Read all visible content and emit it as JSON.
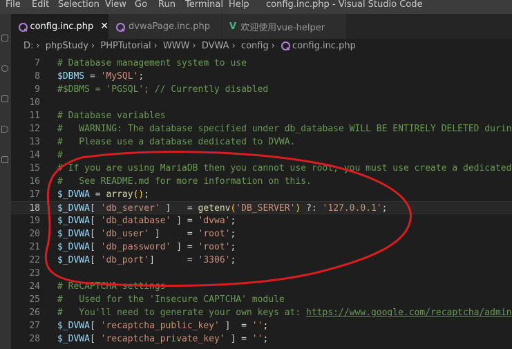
{
  "menu": {
    "items": [
      "File",
      "Edit",
      "Selection",
      "View",
      "Go",
      "Run",
      "Terminal",
      "Help"
    ],
    "window_title": "config.inc.php - Visual Studio Code"
  },
  "tabs": [
    {
      "label": "config.inc.php",
      "icon": "php-icon",
      "active": true,
      "close": "✕"
    },
    {
      "label": "dvwaPage.inc.php",
      "icon": "php-icon",
      "active": false
    },
    {
      "label": "欢迎使用vue-helper",
      "icon": "vue-icon",
      "active": false
    }
  ],
  "breadcrumb": [
    "D:",
    "phpStudy",
    "PHPTutorial",
    "WWW",
    "DVWA",
    "config",
    "config.inc.php"
  ],
  "breadcrumb_sep": "›",
  "colors": {
    "annotation": "#d81e1e",
    "comment": "#6a9955",
    "variable": "#9cdcfe",
    "string": "#ce9178",
    "function": "#dcdcaa"
  },
  "annotation_shape": "red freehand ellipse around lines 15-23",
  "editor": {
    "current_line": 18,
    "lines": [
      {
        "n": "7",
        "tokens": [
          {
            "t": "# Database management system to use",
            "c": "comment"
          }
        ]
      },
      {
        "n": "8",
        "tokens": [
          {
            "t": "$DBMS",
            "c": "var"
          },
          {
            "t": " = ",
            "c": "op"
          },
          {
            "t": "'MySQL'",
            "c": "str"
          },
          {
            "t": ";",
            "c": "op"
          }
        ]
      },
      {
        "n": "9",
        "tokens": [
          {
            "t": "#$DBMS = 'PGSQL'; // Currently disabled",
            "c": "comment"
          }
        ]
      },
      {
        "n": "10",
        "tokens": []
      },
      {
        "n": "11",
        "tokens": [
          {
            "t": "# Database variables",
            "c": "comment"
          }
        ]
      },
      {
        "n": "12",
        "tokens": [
          {
            "t": "#   WARNING: The database specified under db_database WILL BE ENTIRELY DELETED during setup.",
            "c": "comment"
          }
        ]
      },
      {
        "n": "13",
        "tokens": [
          {
            "t": "#   Please use a database dedicated to DVWA.",
            "c": "comment"
          }
        ]
      },
      {
        "n": "14",
        "tokens": [
          {
            "t": "#",
            "c": "comment"
          }
        ]
      },
      {
        "n": "15",
        "tokens": [
          {
            "t": "# If you are using MariaDB then you cannot use root, you must use create a dedicated DVWA user.",
            "c": "comment"
          }
        ]
      },
      {
        "n": "16",
        "tokens": [
          {
            "t": "#   See README.md for more information on this.",
            "c": "comment"
          }
        ]
      },
      {
        "n": "17",
        "tokens": [
          {
            "t": "$_DVWA",
            "c": "var"
          },
          {
            "t": " = ",
            "c": "op"
          },
          {
            "t": "array",
            "c": "fn"
          },
          {
            "t": "()",
            "c": "br"
          },
          {
            "t": ";",
            "c": "op"
          }
        ]
      },
      {
        "n": "18",
        "tokens": [
          {
            "t": "$_DVWA",
            "c": "var"
          },
          {
            "t": "[ ",
            "c": "op"
          },
          {
            "t": "'db_server'",
            "c": "str"
          },
          {
            "t": " ]   = ",
            "c": "op"
          },
          {
            "t": "getenv",
            "c": "fn"
          },
          {
            "t": "(",
            "c": "br"
          },
          {
            "t": "'DB_SERVER'",
            "c": "str"
          },
          {
            "t": ")",
            "c": "br"
          },
          {
            "t": " ?: ",
            "c": "op"
          },
          {
            "t": "'127.0.0.1'",
            "c": "str"
          },
          {
            "t": ";",
            "c": "op"
          }
        ]
      },
      {
        "n": "19",
        "tokens": [
          {
            "t": "$_DVWA",
            "c": "var"
          },
          {
            "t": "[ ",
            "c": "op"
          },
          {
            "t": "'db_database'",
            "c": "str"
          },
          {
            "t": " ] = ",
            "c": "op"
          },
          {
            "t": "'dvwa'",
            "c": "str"
          },
          {
            "t": ";",
            "c": "op"
          }
        ]
      },
      {
        "n": "20",
        "tokens": [
          {
            "t": "$_DVWA",
            "c": "var"
          },
          {
            "t": "[ ",
            "c": "op"
          },
          {
            "t": "'db_user'",
            "c": "str"
          },
          {
            "t": " ]     = ",
            "c": "op"
          },
          {
            "t": "'root'",
            "c": "str"
          },
          {
            "t": ";",
            "c": "op"
          }
        ]
      },
      {
        "n": "21",
        "tokens": [
          {
            "t": "$_DVWA",
            "c": "var"
          },
          {
            "t": "[ ",
            "c": "op"
          },
          {
            "t": "'db_password'",
            "c": "str"
          },
          {
            "t": " ] = ",
            "c": "op"
          },
          {
            "t": "'root'",
            "c": "str"
          },
          {
            "t": ";",
            "c": "op"
          }
        ]
      },
      {
        "n": "22",
        "tokens": [
          {
            "t": "$_DVWA",
            "c": "var"
          },
          {
            "t": "[ ",
            "c": "op"
          },
          {
            "t": "'db_port'",
            "c": "str"
          },
          {
            "t": "]      = ",
            "c": "op"
          },
          {
            "t": "'3306'",
            "c": "str"
          },
          {
            "t": ";",
            "c": "op"
          }
        ]
      },
      {
        "n": "23",
        "tokens": []
      },
      {
        "n": "24",
        "tokens": [
          {
            "t": "# ReCAPTCHA settings",
            "c": "comment"
          }
        ]
      },
      {
        "n": "25",
        "tokens": [
          {
            "t": "#   Used for the 'Insecure CAPTCHA' module",
            "c": "comment"
          }
        ]
      },
      {
        "n": "26",
        "tokens": [
          {
            "t": "#   You'll need to generate your own keys at: ",
            "c": "comment"
          },
          {
            "t": "https://www.google.com/recaptcha/admin",
            "c": "link"
          }
        ]
      },
      {
        "n": "27",
        "tokens": [
          {
            "t": "$_DVWA",
            "c": "var"
          },
          {
            "t": "[ ",
            "c": "op"
          },
          {
            "t": "'recaptcha_public_key'",
            "c": "str"
          },
          {
            "t": " ]  = ",
            "c": "op"
          },
          {
            "t": "''",
            "c": "str"
          },
          {
            "t": ";",
            "c": "op"
          }
        ]
      },
      {
        "n": "28",
        "tokens": [
          {
            "t": "$_DVWA",
            "c": "var"
          },
          {
            "t": "[ ",
            "c": "op"
          },
          {
            "t": "'recaptcha_private_key'",
            "c": "str"
          },
          {
            "t": " ] = ",
            "c": "op"
          },
          {
            "t": "''",
            "c": "str"
          },
          {
            "t": ";",
            "c": "op"
          }
        ]
      }
    ]
  }
}
